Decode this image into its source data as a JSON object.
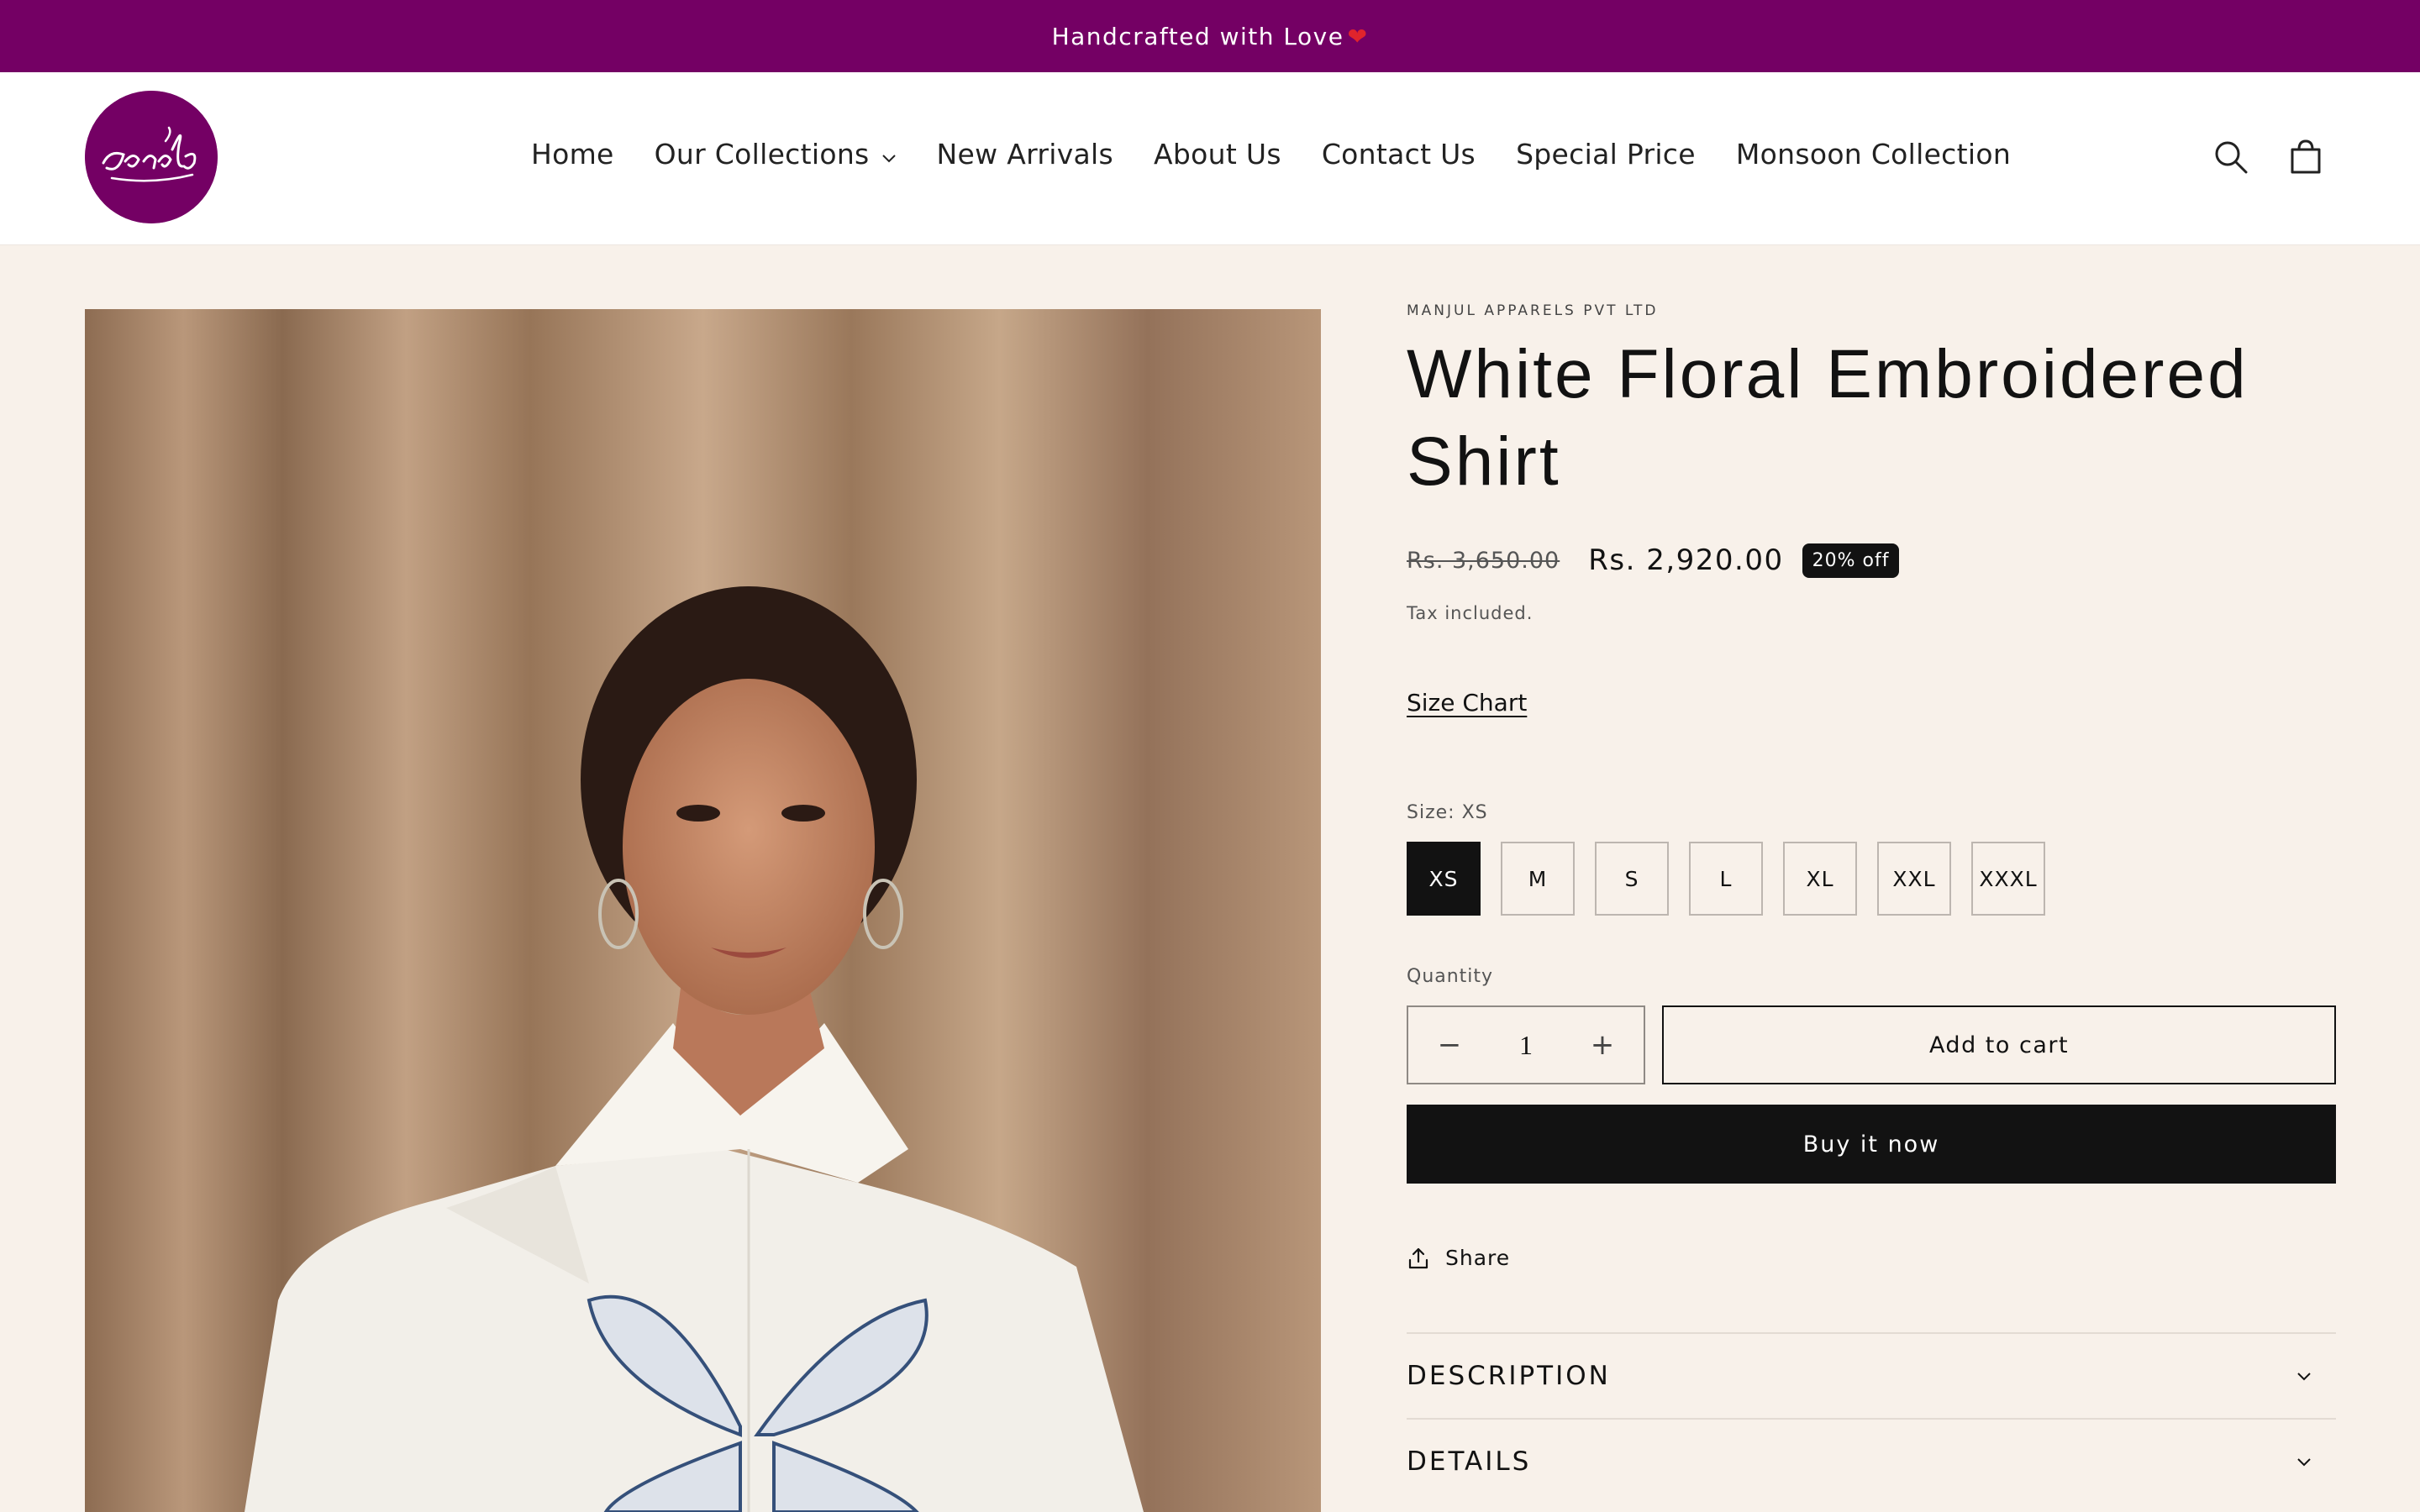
{
  "announcement": {
    "text": "Handcrafted with Love",
    "emoji": "❤"
  },
  "header": {
    "logo_text": "Jasahr",
    "nav": [
      {
        "label": "Home"
      },
      {
        "label": "Our Collections",
        "has_dropdown": true
      },
      {
        "label": "New Arrivals"
      },
      {
        "label": "About Us"
      },
      {
        "label": "Contact Us"
      },
      {
        "label": "Special Price"
      },
      {
        "label": "Monsoon Collection"
      }
    ],
    "icons": [
      "search-icon",
      "cart-icon"
    ]
  },
  "product": {
    "vendor": "MANJUL APPARELS PVT LTD",
    "title": "White Floral Embroidered Shirt",
    "price_old": "Rs. 3,650.00",
    "price_new": "Rs. 2,920.00",
    "discount_badge": "20% off",
    "tax_note": "Tax included.",
    "size_chart_label": "Size Chart",
    "size_label": "Size: XS",
    "sizes": [
      "XS",
      "M",
      "S",
      "L",
      "XL",
      "XXL",
      "XXXL"
    ],
    "selected_size": "XS",
    "quantity_label": "Quantity",
    "quantity": "1",
    "add_to_cart": "Add to cart",
    "buy_now": "Buy it now",
    "share": "Share",
    "accordion": [
      {
        "title": "DESCRIPTION"
      },
      {
        "title": "DETAILS"
      }
    ]
  },
  "colors": {
    "brand": "#740064",
    "background": "#f8f1ea",
    "text": "#121212"
  }
}
